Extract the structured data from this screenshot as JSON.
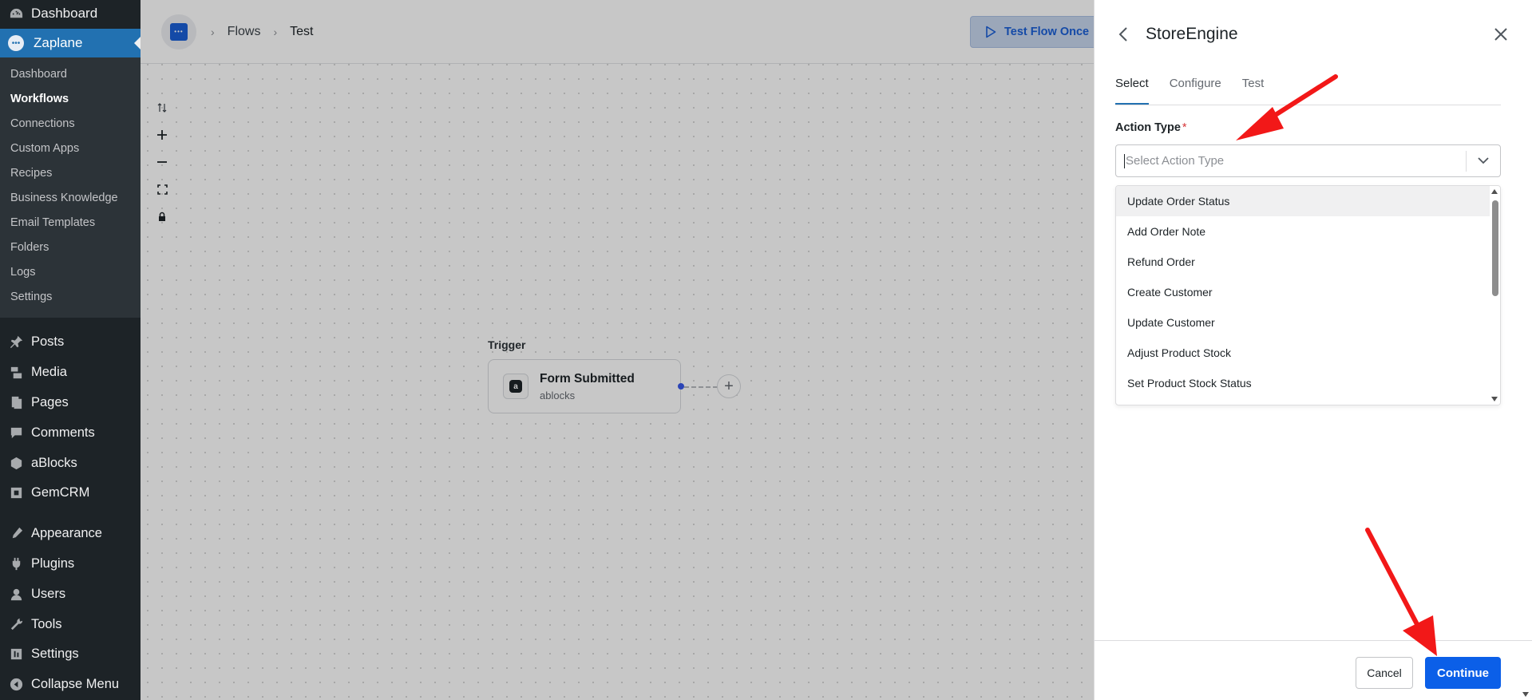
{
  "wp_sidebar": {
    "dashboard_label": "Dashboard",
    "active_label": "Zaplane",
    "submenu": [
      {
        "label": "Dashboard",
        "current": false
      },
      {
        "label": "Workflows",
        "current": true
      },
      {
        "label": "Connections",
        "current": false
      },
      {
        "label": "Custom Apps",
        "current": false
      },
      {
        "label": "Recipes",
        "current": false
      },
      {
        "label": "Business Knowledge",
        "current": false
      },
      {
        "label": "Email Templates",
        "current": false
      },
      {
        "label": "Folders",
        "current": false
      },
      {
        "label": "Logs",
        "current": false
      },
      {
        "label": "Settings",
        "current": false
      }
    ],
    "menu": [
      {
        "label": "Posts",
        "icon": "pin-icon"
      },
      {
        "label": "Media",
        "icon": "media-icon"
      },
      {
        "label": "Pages",
        "icon": "pages-icon"
      },
      {
        "label": "Comments",
        "icon": "comments-icon"
      },
      {
        "label": "aBlocks",
        "icon": "ablocks-icon"
      },
      {
        "label": "GemCRM",
        "icon": "gemcrm-icon"
      },
      {
        "label": "Appearance",
        "icon": "appearance-icon"
      },
      {
        "label": "Plugins",
        "icon": "plugins-icon"
      },
      {
        "label": "Users",
        "icon": "users-icon"
      },
      {
        "label": "Tools",
        "icon": "tools-icon"
      },
      {
        "label": "Settings",
        "icon": "settings-icon"
      },
      {
        "label": "Collapse Menu",
        "icon": "collapse-icon"
      }
    ]
  },
  "flow": {
    "breadcrumb": [
      "Flows",
      "Test"
    ],
    "test_button_label": "Test Flow Once",
    "trigger_label": "Trigger",
    "node": {
      "title": "Form Submitted",
      "subtitle": "ablocks"
    }
  },
  "panel": {
    "title": "StoreEngine",
    "tabs": [
      "Select",
      "Configure",
      "Test"
    ],
    "active_tab": "Select",
    "field_label": "Action Type",
    "required_mark": "*",
    "placeholder": "Select Action Type",
    "options": [
      "Update Order Status",
      "Add Order Note",
      "Refund Order",
      "Create Customer",
      "Update Customer",
      "Adjust Product Stock",
      "Set Product Stock Status"
    ],
    "cancel_label": "Cancel",
    "continue_label": "Continue"
  },
  "colors": {
    "wp_sidebar": "#1d2327",
    "wp_active": "#2271b1",
    "primary": "#0b5fe8",
    "annotation_arrow": "#f21818"
  }
}
